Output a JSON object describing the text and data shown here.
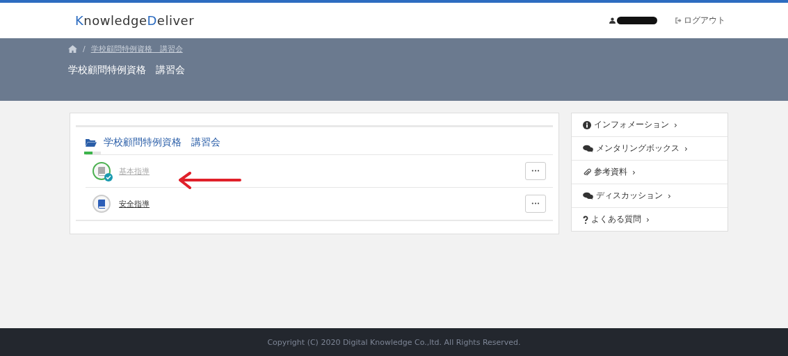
{
  "header": {
    "logo": [
      {
        "text": "K",
        "accent": true
      },
      {
        "text": "nowledge",
        "accent": false
      },
      {
        "text": "D",
        "accent": true
      },
      {
        "text": "eliver",
        "accent": false
      }
    ],
    "logout": "ログアウト"
  },
  "banner": {
    "separator": "/",
    "breadcrumb": "学校顧問特例資格　講習会",
    "title": "学校顧問特例資格　講習会"
  },
  "course": {
    "title": "学校顧問特例資格　講習会",
    "level": 0.5,
    "lessons": [
      {
        "title": "基本指導",
        "completed": true,
        "more": "•••"
      },
      {
        "title": "安全指導",
        "completed": false,
        "more": "•••"
      }
    ]
  },
  "sidebar": {
    "items": [
      {
        "kind": "info",
        "label": "インフォメーション",
        "chevron": "›"
      },
      {
        "kind": "chat",
        "label": "メンタリングボックス",
        "chevron": "›"
      },
      {
        "kind": "clip",
        "label": "参考資料",
        "chevron": "›"
      },
      {
        "kind": "chat",
        "label": "ディスカッション",
        "chevron": "›"
      },
      {
        "kind": "faq",
        "label": "よくある質問",
        "chevron": "›"
      }
    ]
  },
  "footer": "Copyright (C) 2020 Digital Knowledge Co.,ltd. All Rights Reserved."
}
